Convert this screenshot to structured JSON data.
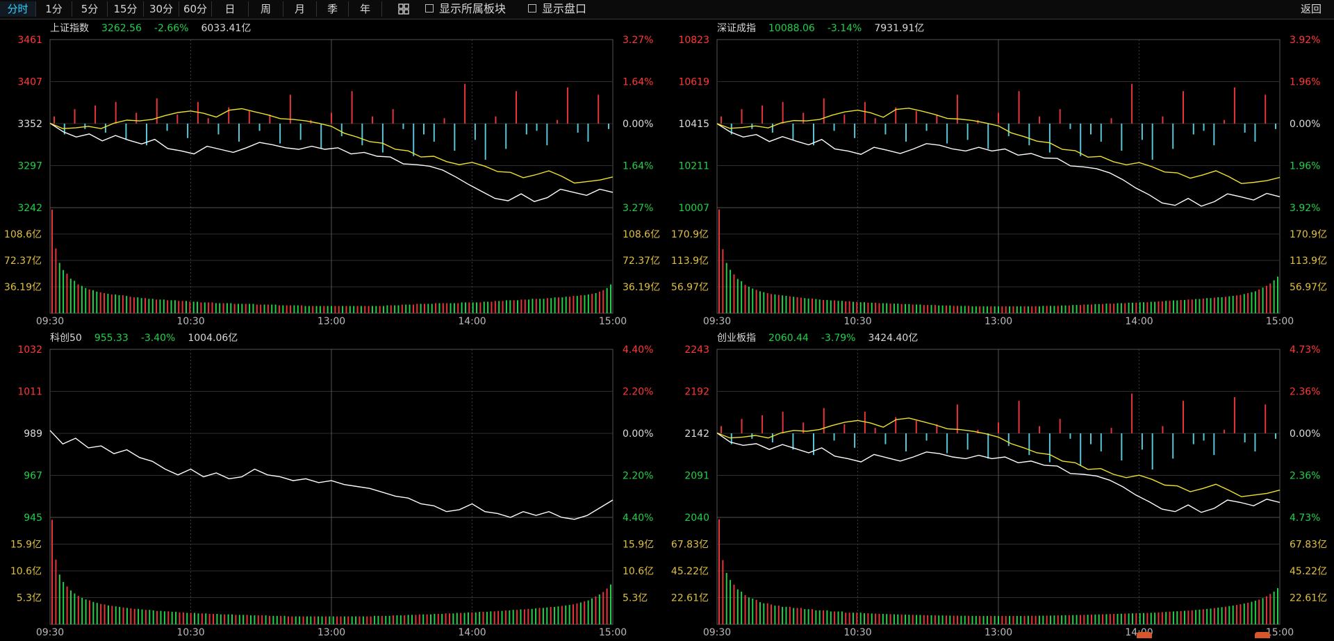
{
  "toolbar": {
    "periods": [
      "分时",
      "1分",
      "5分",
      "15分",
      "30分",
      "60分",
      "日",
      "周",
      "月",
      "季",
      "年"
    ],
    "active_period": "分时",
    "show_sector_label": "显示所属板块",
    "show_orderbook_label": "显示盘口",
    "back_label": "返回"
  },
  "colors": {
    "up": "#ff3838",
    "down": "#22d04a",
    "neutral": "#dddddd",
    "volume_label": "#e0c040",
    "white_line": "#ffffff",
    "yellow_line": "#f0e22b",
    "bar_up": "#e8343a",
    "bar_down": "#55c8d8",
    "grid": "#2e2e2e",
    "grid_major": "#555555"
  },
  "chart_data": [
    {
      "type": "line",
      "name": "上证指数",
      "price": "3262.56",
      "change": "-2.66%",
      "amount": "6033.41亿",
      "price_ticks": [
        "3461",
        "3407",
        "3352",
        "3297",
        "3242"
      ],
      "pct_ticks": [
        "3.27%",
        "1.64%",
        "0.00%",
        "1.64%",
        "3.27%"
      ],
      "volume_ticks": [
        "108.6亿",
        "72.37亿",
        "36.19亿"
      ],
      "x_ticks": [
        "09:30",
        "10:30",
        "13:00",
        "14:00",
        "15:00"
      ],
      "ylim": [
        3242,
        3461
      ],
      "volume_max": 144.8,
      "has_yellow": true,
      "white_series": [
        3352,
        3341,
        3334,
        3338,
        3329,
        3336,
        3330,
        3325,
        3331,
        3319,
        3316,
        3312,
        3322,
        3318,
        3314,
        3320,
        3327,
        3324,
        3320,
        3318,
        3322,
        3318,
        3320,
        3312,
        3314,
        3309,
        3308,
        3299,
        3298,
        3296,
        3291,
        3282,
        3272,
        3263,
        3254,
        3251,
        3260,
        3250,
        3255,
        3266,
        3262,
        3258,
        3266,
        3262
      ],
      "yellow_series": [
        3352,
        3345,
        3346,
        3348,
        3345,
        3352,
        3356,
        3355,
        3357,
        3362,
        3366,
        3368,
        3365,
        3360,
        3369,
        3371,
        3367,
        3363,
        3358,
        3357,
        3355,
        3352,
        3348,
        3339,
        3334,
        3328,
        3326,
        3318,
        3316,
        3308,
        3309,
        3302,
        3298,
        3301,
        3296,
        3289,
        3288,
        3281,
        3285,
        3290,
        3283,
        3274,
        3276,
        3278,
        3282
      ],
      "up_down_bars": [
        4,
        -6,
        8,
        -3,
        10,
        -5,
        12,
        -9,
        6,
        -12,
        14,
        -4,
        5,
        -8,
        12,
        3,
        -6,
        9,
        -10,
        7,
        -4,
        5,
        -11,
        16,
        -9,
        2,
        -14,
        6,
        -7,
        18,
        -12,
        4,
        -16,
        8,
        -3,
        -18,
        -6,
        -10,
        3,
        -15,
        22,
        -9,
        -20,
        4,
        -14,
        18,
        -6,
        -4,
        -12,
        2,
        20,
        -5,
        -10,
        16,
        -3
      ],
      "volume_bars": [
        144,
        90,
        70,
        60,
        55,
        48,
        45,
        40,
        38,
        35,
        33,
        32,
        30,
        29,
        28,
        27,
        26,
        26,
        25,
        25,
        24,
        23,
        22,
        22,
        21,
        21,
        20,
        20,
        19,
        19,
        19,
        18,
        18,
        18,
        17,
        17,
        17,
        16,
        16,
        16,
        15,
        15,
        15,
        15,
        14,
        14,
        14,
        14,
        14,
        13,
        13,
        13,
        13,
        13,
        13,
        12,
        12,
        12,
        12,
        12,
        12,
        11,
        11,
        11,
        11,
        11,
        11,
        11,
        10,
        10,
        10,
        10,
        10,
        10,
        10,
        10,
        10,
        10,
        10,
        10,
        10,
        10,
        10,
        10,
        10,
        10,
        10,
        10,
        10,
        10,
        11,
        11,
        11,
        11,
        12,
        12,
        12,
        12,
        13,
        13,
        13,
        13,
        13,
        14,
        14,
        14,
        14,
        14,
        14,
        14,
        15,
        15,
        15,
        15,
        15,
        15,
        16,
        16,
        16,
        17,
        17,
        17,
        18,
        18,
        18,
        18,
        19,
        19,
        19,
        20,
        20,
        20,
        20,
        21,
        21,
        22,
        22,
        22,
        23,
        23,
        24,
        24,
        25,
        25,
        26,
        27,
        28,
        30,
        32,
        35,
        40
      ]
    },
    {
      "type": "line",
      "name": "深证成指",
      "price": "10088.06",
      "change": "-3.14%",
      "amount": "7931.91亿",
      "price_ticks": [
        "10823",
        "10619",
        "10415",
        "10211",
        "10007"
      ],
      "pct_ticks": [
        "3.92%",
        "1.96%",
        "0.00%",
        "1.96%",
        "3.92%"
      ],
      "volume_ticks": [
        "170.9亿",
        "113.9亿",
        "56.97亿"
      ],
      "x_ticks": [
        "09:30",
        "10:30",
        "13:00",
        "14:00",
        "15:00"
      ],
      "ylim": [
        10007,
        10823
      ],
      "volume_max": 227.9,
      "has_yellow": true,
      "white_series": [
        10415,
        10375,
        10350,
        10362,
        10328,
        10352,
        10331,
        10312,
        10338,
        10292,
        10282,
        10266,
        10300,
        10286,
        10270,
        10292,
        10318,
        10310,
        10292,
        10282,
        10300,
        10282,
        10292,
        10262,
        10270,
        10248,
        10246,
        10210,
        10205,
        10196,
        10176,
        10143,
        10102,
        10070,
        10030,
        10018,
        10052,
        10014,
        10036,
        10074,
        10060,
        10044,
        10076,
        10060
      ],
      "yellow_series": [
        10415,
        10392,
        10396,
        10404,
        10394,
        10418,
        10430,
        10428,
        10435,
        10456,
        10472,
        10480,
        10468,
        10446,
        10484,
        10490,
        10476,
        10460,
        10440,
        10437,
        10430,
        10418,
        10404,
        10370,
        10352,
        10330,
        10322,
        10290,
        10284,
        10252,
        10256,
        10230,
        10215,
        10226,
        10206,
        10180,
        10176,
        10150,
        10166,
        10186,
        10158,
        10124,
        10130,
        10138,
        10154
      ],
      "up_down_bars": [
        4,
        -6,
        8,
        -3,
        10,
        -5,
        12,
        -9,
        6,
        -12,
        14,
        -4,
        5,
        -8,
        12,
        3,
        -6,
        9,
        -10,
        7,
        -4,
        5,
        -11,
        16,
        -9,
        2,
        -14,
        6,
        -7,
        18,
        -12,
        4,
        -16,
        8,
        -3,
        -18,
        -6,
        -10,
        3,
        -15,
        22,
        -9,
        -20,
        4,
        -14,
        18,
        -6,
        -4,
        -12,
        2,
        20,
        -5,
        -10,
        16,
        -3
      ],
      "volume_bars": [
        227,
        140,
        110,
        95,
        85,
        75,
        70,
        62,
        58,
        54,
        51,
        48,
        46,
        44,
        42,
        41,
        40,
        39,
        38,
        37,
        36,
        35,
        34,
        33,
        32,
        32,
        31,
        30,
        29,
        29,
        28,
        28,
        27,
        27,
        26,
        26,
        25,
        25,
        24,
        24,
        23,
        23,
        23,
        22,
        22,
        22,
        21,
        21,
        21,
        20,
        20,
        20,
        19,
        19,
        19,
        18,
        18,
        18,
        18,
        17,
        17,
        17,
        17,
        16,
        16,
        16,
        16,
        16,
        15,
        15,
        15,
        15,
        15,
        15,
        15,
        15,
        15,
        15,
        15,
        15,
        15,
        15,
        15,
        15,
        15,
        15,
        15,
        16,
        16,
        16,
        16,
        16,
        17,
        17,
        17,
        18,
        18,
        18,
        19,
        19,
        19,
        20,
        20,
        20,
        21,
        21,
        21,
        22,
        22,
        22,
        23,
        23,
        23,
        24,
        24,
        24,
        25,
        25,
        26,
        26,
        27,
        27,
        28,
        28,
        29,
        29,
        30,
        30,
        31,
        31,
        32,
        33,
        33,
        34,
        35,
        35,
        36,
        37,
        38,
        39,
        40,
        42,
        44,
        46,
        48,
        52,
        56,
        60,
        65,
        72,
        80
      ]
    },
    {
      "type": "line",
      "name": "科创50",
      "price": "955.33",
      "change": "-3.40%",
      "amount": "1004.06亿",
      "price_ticks": [
        "1032",
        "1011",
        "989",
        "967",
        "945"
      ],
      "pct_ticks": [
        "4.40%",
        "2.20%",
        "0.00%",
        "2.20%",
        "4.40%"
      ],
      "volume_ticks": [
        "15.9亿",
        "10.6亿",
        "5.3亿"
      ],
      "x_ticks": [
        "09:30",
        "10:30",
        "13:00",
        "14:00",
        "15:00"
      ],
      "ylim": [
        945,
        1032
      ],
      "volume_max": 21.2,
      "has_yellow": false,
      "white_series": [
        990,
        983,
        986,
        981,
        982,
        978,
        980,
        976,
        974,
        970,
        967,
        970,
        966,
        968,
        965,
        966,
        970,
        967,
        966,
        964,
        965,
        963,
        964,
        962,
        961,
        960,
        958,
        956,
        955,
        952,
        951,
        948,
        949,
        952,
        948,
        947,
        945,
        948,
        946,
        948,
        945,
        944,
        946,
        950,
        954
      ],
      "yellow_series": [],
      "up_down_bars": [],
      "volume_bars": [
        21,
        13,
        10,
        8.5,
        7.6,
        6.8,
        6.2,
        5.7,
        5.3,
        5,
        4.8,
        4.5,
        4.3,
        4.1,
        4,
        3.8,
        3.7,
        3.6,
        3.5,
        3.4,
        3.3,
        3.2,
        3.1,
        3.1,
        3,
        2.9,
        2.9,
        2.8,
        2.7,
        2.7,
        2.6,
        2.6,
        2.5,
        2.5,
        2.4,
        2.4,
        2.3,
        2.3,
        2.3,
        2.2,
        2.2,
        2.2,
        2.1,
        2.1,
        2.1,
        2,
        2,
        2,
        2,
        1.9,
        1.9,
        1.9,
        1.9,
        1.8,
        1.8,
        1.8,
        1.8,
        1.8,
        1.7,
        1.7,
        1.7,
        1.7,
        1.7,
        1.6,
        1.6,
        1.6,
        1.6,
        1.6,
        1.6,
        1.6,
        1.6,
        1.6,
        1.6,
        1.6,
        1.6,
        1.6,
        1.6,
        1.6,
        1.6,
        1.6,
        1.6,
        1.6,
        1.6,
        1.6,
        1.6,
        1.6,
        1.7,
        1.7,
        1.7,
        1.7,
        1.7,
        1.8,
        1.8,
        1.8,
        1.8,
        1.9,
        1.9,
        1.9,
        2,
        2,
        2,
        2,
        2.1,
        2.1,
        2.1,
        2.2,
        2.2,
        2.2,
        2.3,
        2.3,
        2.3,
        2.4,
        2.4,
        2.4,
        2.5,
        2.5,
        2.5,
        2.6,
        2.6,
        2.7,
        2.7,
        2.8,
        2.8,
        2.9,
        2.9,
        3,
        3,
        3.1,
        3.1,
        3.2,
        3.3,
        3.3,
        3.4,
        3.5,
        3.5,
        3.6,
        3.7,
        3.8,
        3.9,
        4,
        4.2,
        4.4,
        4.6,
        4.8,
        5.2,
        5.6,
        6,
        6.5,
        7.2,
        8
      ]
    },
    {
      "type": "line",
      "name": "创业板指",
      "price": "2060.44",
      "change": "-3.79%",
      "amount": "3424.40亿",
      "price_ticks": [
        "2243",
        "2192",
        "2142",
        "2091",
        "2040"
      ],
      "pct_ticks": [
        "4.73%",
        "2.36%",
        "0.00%",
        "2.36%",
        "4.73%"
      ],
      "volume_ticks": [
        "67.83亿",
        "45.22亿",
        "22.61亿"
      ],
      "x_ticks": [
        "09:30",
        "10:30",
        "13:00",
        "14:00",
        "15:00"
      ],
      "ylim": [
        2040,
        2243
      ],
      "volume_max": 90.4,
      "has_yellow": true,
      "white_series": [
        2142,
        2131,
        2127,
        2129,
        2122,
        2128,
        2123,
        2118,
        2124,
        2114,
        2111,
        2107,
        2116,
        2112,
        2108,
        2113,
        2119,
        2117,
        2113,
        2111,
        2115,
        2111,
        2113,
        2106,
        2108,
        2103,
        2102,
        2093,
        2092,
        2090,
        2085,
        2077,
        2067,
        2059,
        2050,
        2047,
        2055,
        2046,
        2051,
        2061,
        2058,
        2054,
        2062,
        2058
      ],
      "yellow_series": [
        2142,
        2136,
        2137,
        2139,
        2136,
        2142,
        2145,
        2144,
        2146,
        2151,
        2155,
        2157,
        2154,
        2149,
        2158,
        2160,
        2156,
        2152,
        2147,
        2146,
        2144,
        2141,
        2137,
        2129,
        2124,
        2118,
        2116,
        2108,
        2106,
        2098,
        2099,
        2092,
        2088,
        2091,
        2086,
        2079,
        2078,
        2071,
        2075,
        2080,
        2073,
        2065,
        2067,
        2069,
        2073
      ],
      "up_down_bars": [
        4,
        -6,
        8,
        -3,
        10,
        -5,
        12,
        -9,
        6,
        -12,
        14,
        -4,
        5,
        -8,
        12,
        3,
        -6,
        9,
        -10,
        7,
        -4,
        5,
        -11,
        16,
        -9,
        2,
        -14,
        6,
        -7,
        18,
        -12,
        4,
        -16,
        8,
        -3,
        -18,
        -6,
        -10,
        3,
        -15,
        22,
        -9,
        -20,
        4,
        -14,
        18,
        -6,
        -4,
        -12,
        2,
        20,
        -5,
        -10,
        16,
        -3
      ],
      "volume_bars": [
        90,
        55,
        44,
        38,
        34,
        30,
        28,
        25,
        23,
        22,
        21,
        19,
        18,
        18,
        17,
        16,
        16,
        15,
        15,
        15,
        14,
        14,
        14,
        13,
        13,
        13,
        12,
        12,
        12,
        12,
        11,
        11,
        11,
        11,
        10,
        10,
        10,
        10,
        10,
        9.5,
        9.5,
        9.3,
        9.2,
        9,
        9,
        8.8,
        8.7,
        8.6,
        8.5,
        8.4,
        8.3,
        8.2,
        8.1,
        8,
        8,
        7.9,
        7.8,
        7.8,
        7.7,
        7.6,
        7.6,
        7.5,
        7.5,
        7.4,
        7.4,
        7.3,
        7.3,
        7.3,
        7.2,
        7.2,
        7.2,
        7.2,
        7.2,
        7.2,
        7.2,
        7.2,
        7.2,
        7.2,
        7.2,
        7.2,
        7.2,
        7.2,
        7.2,
        7.3,
        7.3,
        7.3,
        7.4,
        7.4,
        7.5,
        7.5,
        7.6,
        7.6,
        7.7,
        7.8,
        7.8,
        7.9,
        8,
        8,
        8.1,
        8.2,
        8.3,
        8.4,
        8.5,
        8.6,
        8.7,
        8.8,
        8.9,
        9,
        9.1,
        9.2,
        9.3,
        9.4,
        9.5,
        9.6,
        9.7,
        9.8,
        9.9,
        10,
        10.2,
        10.4,
        10.6,
        10.8,
        11,
        11.2,
        11.4,
        11.6,
        11.8,
        12,
        12.3,
        12.6,
        12.9,
        13.2,
        13.5,
        13.9,
        14.3,
        14.7,
        15.1,
        15.6,
        16.1,
        16.6,
        17.2,
        17.8,
        18.5,
        19.3,
        20.2,
        21.2,
        22.4,
        24,
        26,
        28,
        31
      ]
    }
  ]
}
